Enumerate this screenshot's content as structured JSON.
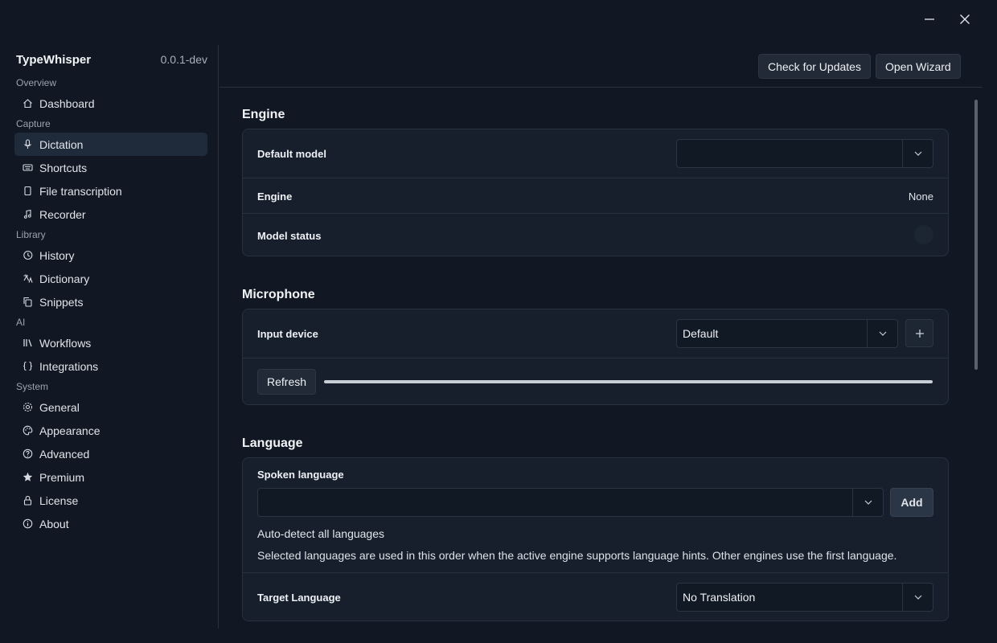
{
  "window": {
    "minimize_icon": "minimize-icon",
    "close_icon": "close-icon"
  },
  "app": {
    "name": "TypeWhisper",
    "version": "0.0.1-dev"
  },
  "sidebar": {
    "groups": [
      {
        "label": "Overview",
        "items": [
          {
            "label": "Dashboard",
            "icon": "home-icon"
          }
        ]
      },
      {
        "label": "Capture",
        "items": [
          {
            "label": "Dictation",
            "icon": "microphone-icon",
            "active": true
          },
          {
            "label": "Shortcuts",
            "icon": "keyboard-icon"
          },
          {
            "label": "File transcription",
            "icon": "file-icon"
          },
          {
            "label": "Recorder",
            "icon": "music-note-icon"
          }
        ]
      },
      {
        "label": "Library",
        "items": [
          {
            "label": "History",
            "icon": "history-icon"
          },
          {
            "label": "Dictionary",
            "icon": "translate-icon"
          },
          {
            "label": "Snippets",
            "icon": "copy-icon"
          }
        ]
      },
      {
        "label": "AI",
        "items": [
          {
            "label": "Workflows",
            "icon": "library-icon"
          },
          {
            "label": "Integrations",
            "icon": "braces-icon"
          }
        ]
      },
      {
        "label": "System",
        "items": [
          {
            "label": "General",
            "icon": "gear-icon"
          },
          {
            "label": "Appearance",
            "icon": "palette-icon"
          },
          {
            "label": "Advanced",
            "icon": "help-circle-icon"
          },
          {
            "label": "Premium",
            "icon": "star-icon"
          },
          {
            "label": "License",
            "icon": "lock-icon"
          },
          {
            "label": "About",
            "icon": "info-icon"
          }
        ]
      }
    ]
  },
  "topbar": {
    "check_updates": "Check for Updates",
    "open_wizard": "Open Wizard"
  },
  "engine": {
    "title": "Engine",
    "default_model_label": "Default model",
    "default_model_value": "",
    "engine_label": "Engine",
    "engine_value": "None",
    "model_status_label": "Model status"
  },
  "microphone": {
    "title": "Microphone",
    "input_device_label": "Input device",
    "input_device_value": "Default",
    "refresh_label": "Refresh",
    "level": 0.0
  },
  "language": {
    "title": "Language",
    "spoken_label": "Spoken language",
    "spoken_value": "",
    "add_label": "Add",
    "auto_detect_text": "Auto-detect all languages",
    "hint_text": "Selected languages are used in this order when the active engine supports language hints. Other engines use the first language.",
    "target_label": "Target Language",
    "target_value": "No Translation"
  }
}
